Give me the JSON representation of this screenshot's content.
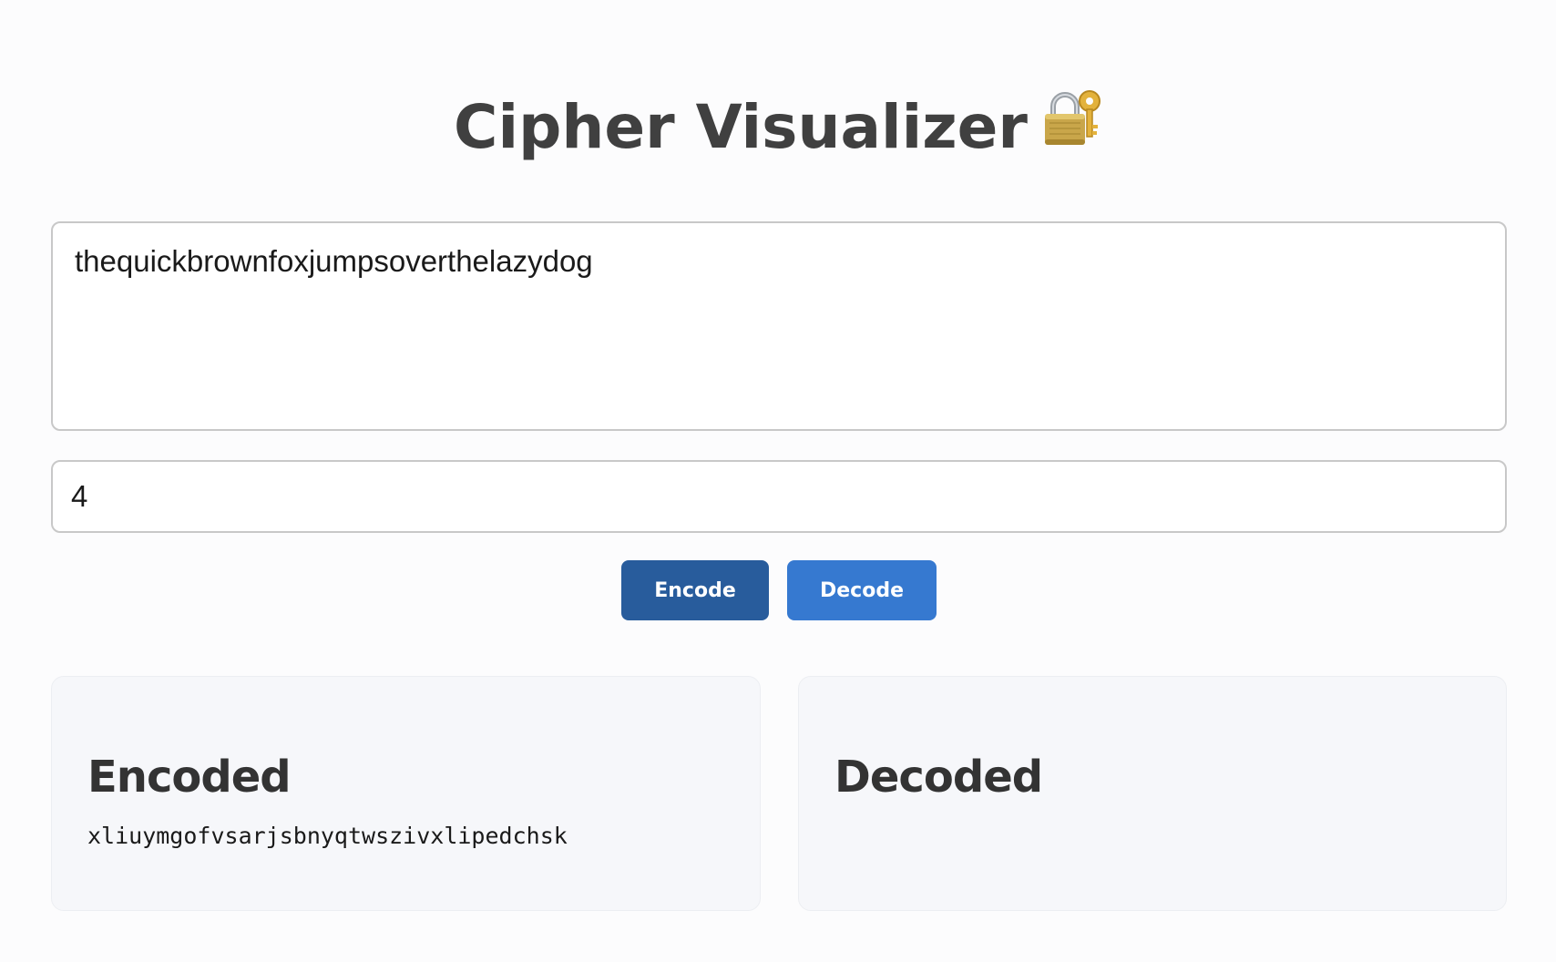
{
  "header": {
    "title": "Cipher Visualizer",
    "title_icon": "lock-with-key-icon"
  },
  "input": {
    "text_value": "thequickbrownfoxjumpsoverthelazydog",
    "shift_value": "4"
  },
  "buttons": {
    "encode_label": "Encode",
    "decode_label": "Decode"
  },
  "results": {
    "encoded_heading": "Encoded",
    "encoded_value": "xliuymgofvsarjsbnyqtwszivxlipedchsk",
    "decoded_heading": "Decoded",
    "decoded_value": ""
  },
  "colors": {
    "encode_button": "#285c9c",
    "decode_button": "#3679d0",
    "panel_background": "#f6f7fa",
    "title_text": "#404040"
  }
}
